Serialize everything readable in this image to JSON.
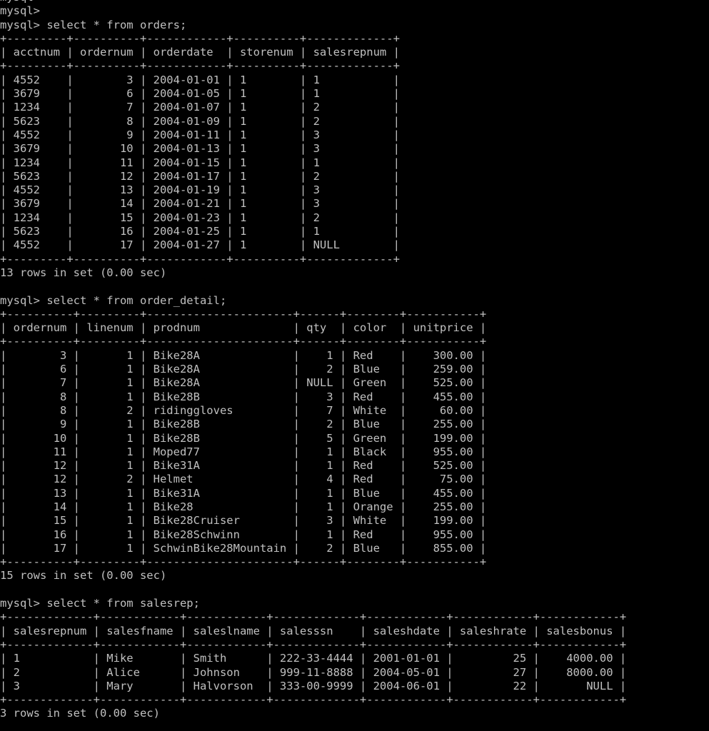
{
  "window": {
    "background": "#000000",
    "foreground": "#c0c0c0"
  },
  "prompt": "mysql>",
  "leading_prompts": 2,
  "sections": [
    {
      "command": "select * from orders;",
      "columns": [
        {
          "name": "acctnum",
          "align": "left"
        },
        {
          "name": "ordernum",
          "align": "right"
        },
        {
          "name": "orderdate",
          "align": "left"
        },
        {
          "name": "storenum",
          "align": "left"
        },
        {
          "name": "salesrepnum",
          "align": "left"
        }
      ],
      "rows": [
        [
          "4552",
          "3",
          "2004-01-01",
          "1",
          "1"
        ],
        [
          "3679",
          "6",
          "2004-01-05",
          "1",
          "1"
        ],
        [
          "1234",
          "7",
          "2004-01-07",
          "1",
          "2"
        ],
        [
          "5623",
          "8",
          "2004-01-09",
          "1",
          "2"
        ],
        [
          "4552",
          "9",
          "2004-01-11",
          "1",
          "3"
        ],
        [
          "3679",
          "10",
          "2004-01-13",
          "1",
          "3"
        ],
        [
          "1234",
          "11",
          "2004-01-15",
          "1",
          "1"
        ],
        [
          "5623",
          "12",
          "2004-01-17",
          "1",
          "2"
        ],
        [
          "4552",
          "13",
          "2004-01-19",
          "1",
          "3"
        ],
        [
          "3679",
          "14",
          "2004-01-21",
          "1",
          "3"
        ],
        [
          "1234",
          "15",
          "2004-01-23",
          "1",
          "2"
        ],
        [
          "5623",
          "16",
          "2004-01-25",
          "1",
          "1"
        ],
        [
          "4552",
          "17",
          "2004-01-27",
          "1",
          "NULL"
        ]
      ],
      "summary": "13 rows in set (0.00 sec)"
    },
    {
      "command": "select * from order_detail;",
      "columns": [
        {
          "name": "ordernum",
          "align": "right"
        },
        {
          "name": "linenum",
          "align": "right"
        },
        {
          "name": "prodnum",
          "align": "left"
        },
        {
          "name": "qty",
          "align": "right"
        },
        {
          "name": "color",
          "align": "left"
        },
        {
          "name": "unitprice",
          "align": "right"
        }
      ],
      "rows": [
        [
          "3",
          "1",
          "Bike28A",
          "1",
          "Red",
          "300.00"
        ],
        [
          "6",
          "1",
          "Bike28A",
          "2",
          "Blue",
          "259.00"
        ],
        [
          "7",
          "1",
          "Bike28A",
          "NULL",
          "Green",
          "525.00"
        ],
        [
          "8",
          "1",
          "Bike28B",
          "3",
          "Red",
          "455.00"
        ],
        [
          "8",
          "2",
          "ridinggloves",
          "7",
          "White",
          "60.00"
        ],
        [
          "9",
          "1",
          "Bike28B",
          "2",
          "Blue",
          "255.00"
        ],
        [
          "10",
          "1",
          "Bike28B",
          "5",
          "Green",
          "199.00"
        ],
        [
          "11",
          "1",
          "Moped77",
          "1",
          "Black",
          "955.00"
        ],
        [
          "12",
          "1",
          "Bike31A",
          "1",
          "Red",
          "525.00"
        ],
        [
          "12",
          "2",
          "Helmet",
          "4",
          "Red",
          "75.00"
        ],
        [
          "13",
          "1",
          "Bike31A",
          "1",
          "Blue",
          "455.00"
        ],
        [
          "14",
          "1",
          "Bike28",
          "1",
          "Orange",
          "255.00"
        ],
        [
          "15",
          "1",
          "Bike28Cruiser",
          "3",
          "White",
          "199.00"
        ],
        [
          "16",
          "1",
          "Bike28Schwinn",
          "1",
          "Red",
          "955.00"
        ],
        [
          "17",
          "1",
          "SchwinBike28Mountain",
          "2",
          "Blue",
          "855.00"
        ]
      ],
      "summary": "15 rows in set (0.00 sec)"
    },
    {
      "command": "select * from salesrep;",
      "columns": [
        {
          "name": "salesrepnum",
          "align": "left"
        },
        {
          "name": "salesfname",
          "align": "left"
        },
        {
          "name": "saleslname",
          "align": "left"
        },
        {
          "name": "salesssn",
          "align": "left"
        },
        {
          "name": "saleshdate",
          "align": "left"
        },
        {
          "name": "saleshrate",
          "align": "right"
        },
        {
          "name": "salesbonus",
          "align": "right"
        }
      ],
      "rows": [
        [
          "1",
          "Mike",
          "Smith",
          "222-33-4444",
          "2001-01-01",
          "25",
          "4000.00"
        ],
        [
          "2",
          "Alice",
          "Johnson",
          "999-11-8888",
          "2004-05-01",
          "27",
          "8000.00"
        ],
        [
          "3",
          "Mary",
          "Halvorson",
          "333-00-9999",
          "2004-06-01",
          "22",
          "NULL"
        ]
      ],
      "summary": "3 rows in set (0.00 sec)"
    }
  ]
}
